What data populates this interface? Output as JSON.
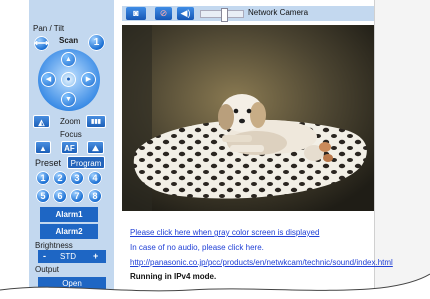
{
  "toolbar": {
    "title": "Network Camera",
    "icons": [
      "camera-icon",
      "no-audio-icon",
      "speaker-icon",
      "volume-slider-icon"
    ]
  },
  "pan_tilt": {
    "label": "Pan / Tilt",
    "scan_label": "Scan",
    "left_icon": "scan-left-icon",
    "right_icon": "scan-right-icon",
    "home_icon": "home-icon"
  },
  "zoom": {
    "label": "Zoom"
  },
  "focus": {
    "label": "Focus",
    "af_label": "AF"
  },
  "preset": {
    "label": "Preset",
    "program_label": "Program",
    "numbers": [
      "1",
      "2",
      "3",
      "4",
      "5",
      "6",
      "7",
      "8"
    ]
  },
  "alarms": [
    "Alarm1",
    "Alarm2"
  ],
  "brightness": {
    "label": "Brightness",
    "minus": "-",
    "value": "STD",
    "plus": "+"
  },
  "output": {
    "label": "Output",
    "open_label": "Open"
  },
  "info": {
    "gray_screen_link": "Please click here when gray color screen is displayed",
    "no_audio_text": "In case of no audio, please click here.",
    "sound_url": "http://panasonic.co.jp/pcc/products/en/netwkcam/technic/sound/index.html",
    "mode_text": "Running in IPv4 mode."
  },
  "colors": {
    "panel": "#c3d8ef",
    "accent": "#1e66c4",
    "link": "#1f3fd6"
  }
}
